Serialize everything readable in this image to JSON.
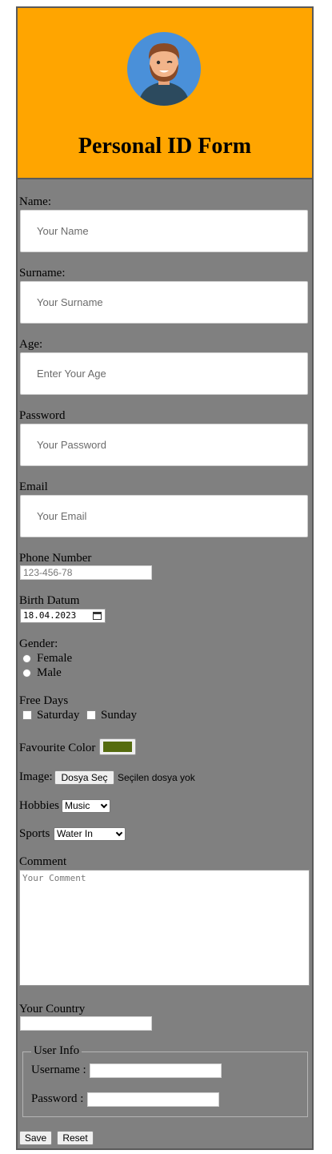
{
  "header": {
    "title": "Personal ID Form",
    "avatar_icon": "man-avatar-icon"
  },
  "form": {
    "name_label": "Name:",
    "name_placeholder": "Your Name",
    "surname_label": "Surname:",
    "surname_placeholder": "Your Surname",
    "age_label": "Age:",
    "age_placeholder": "Enter Your Age",
    "password_label": "Password",
    "password_placeholder": "Your Password",
    "email_label": "Email",
    "email_placeholder": "Your Email",
    "phone_label": "Phone Number",
    "phone_placeholder": "123-456-78",
    "birth_label": "Birth Datum",
    "birth_value": "18.04.2023",
    "gender_label": "Gender:",
    "gender_options": [
      "Female",
      "Male"
    ],
    "free_days_label": "Free Days",
    "free_days_options": [
      "Saturday",
      "Sunday"
    ],
    "color_label": "Favourite Color",
    "color_value": "#556b0f",
    "image_label": "Image:",
    "file_button": "Dosya Seç",
    "file_status": "Seçilen dosya yok",
    "hobbies_label": "Hobbies",
    "hobbies_value": "Music",
    "sports_label": "Sports",
    "sports_value": "Water In",
    "comment_label": "Comment",
    "comment_placeholder": "Your Comment",
    "country_label": "Your Country",
    "user_info_legend": "User Info",
    "username_label": "Username :",
    "user_password_label": "Password :",
    "save_button": "Save",
    "reset_button": "Reset"
  },
  "colors": {
    "header_bg": "#ffa500",
    "form_bg": "#808080"
  }
}
